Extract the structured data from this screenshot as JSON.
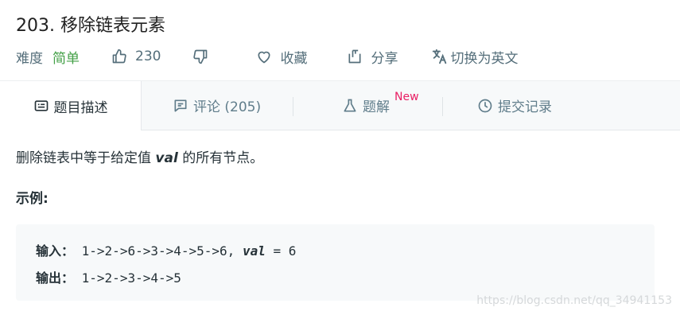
{
  "problem": {
    "title": "203. 移除链表元素",
    "difficulty_label": "难度",
    "difficulty_value": "简单",
    "likes": "230",
    "favorite_label": "收藏",
    "share_label": "分享",
    "lang_label": "切换为英文"
  },
  "tabs": [
    {
      "label": "题目描述",
      "icon": "description-icon"
    },
    {
      "label": "评论 (205)",
      "icon": "comment-icon"
    },
    {
      "label": "题解",
      "icon": "flask-icon",
      "badge": "New"
    },
    {
      "label": "提交记录",
      "icon": "clock-icon"
    }
  ],
  "content": {
    "desc_pre": "删除链表中等于给定值 ",
    "desc_kw": "val",
    "desc_post": " 的所有节点。",
    "example_title": "示例:",
    "input_label": "输入：",
    "input_value": " 1->2->6->3->4->5->6, ",
    "input_kw": "val",
    "input_tail": " = 6",
    "output_label": "输出：",
    "output_value": " 1->2->3->4->5"
  },
  "watermark": "https://blog.csdn.net/qq_34941153",
  "colors": {
    "easy": "#43a047",
    "new_badge": "#e91e63",
    "accent_text": "#546e7a"
  }
}
